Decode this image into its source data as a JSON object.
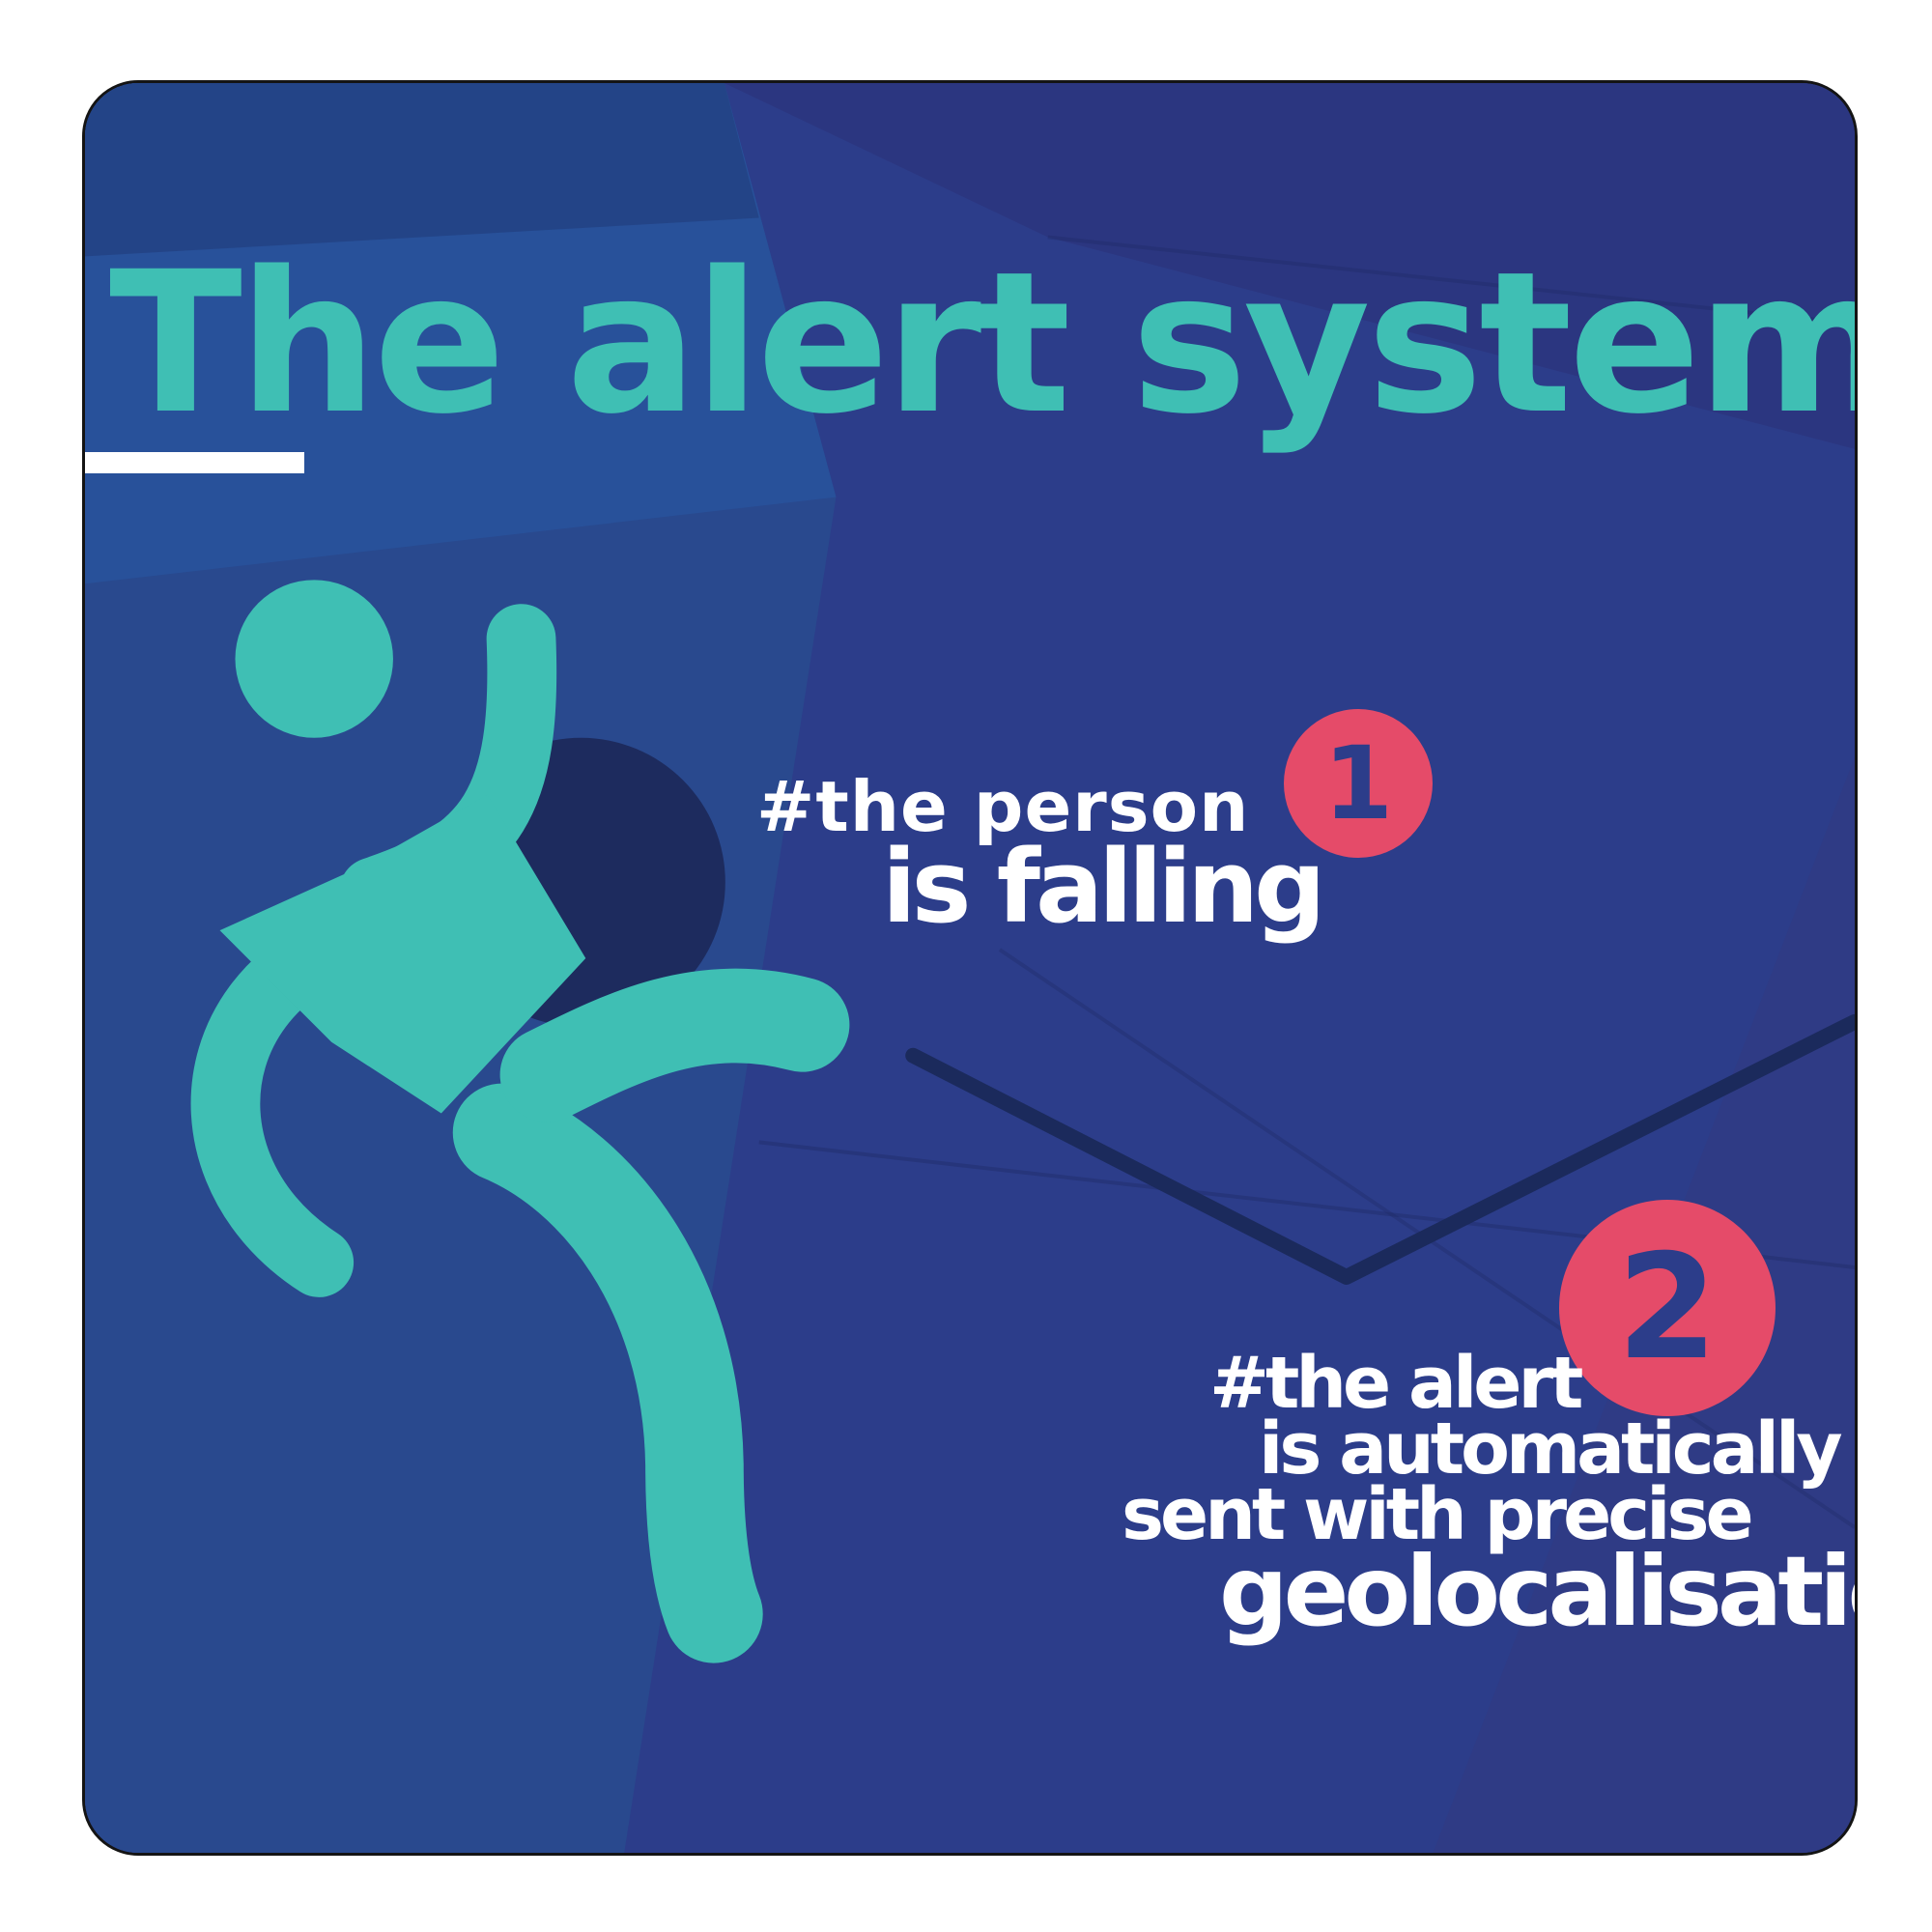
{
  "title": "The alert system",
  "steps": [
    {
      "number": "1",
      "lines": [
        "#the person",
        "is falling"
      ]
    },
    {
      "number": "2",
      "lines": [
        "#the alert",
        "is automatically",
        "sent with precise",
        "geolocalisation"
      ]
    }
  ],
  "icons": {
    "figure": "falling-person-icon"
  },
  "colors": {
    "background": "#2c3d8a",
    "accent": "#3fbfb4",
    "badge": "#e54b69",
    "text": "#ffffff"
  }
}
